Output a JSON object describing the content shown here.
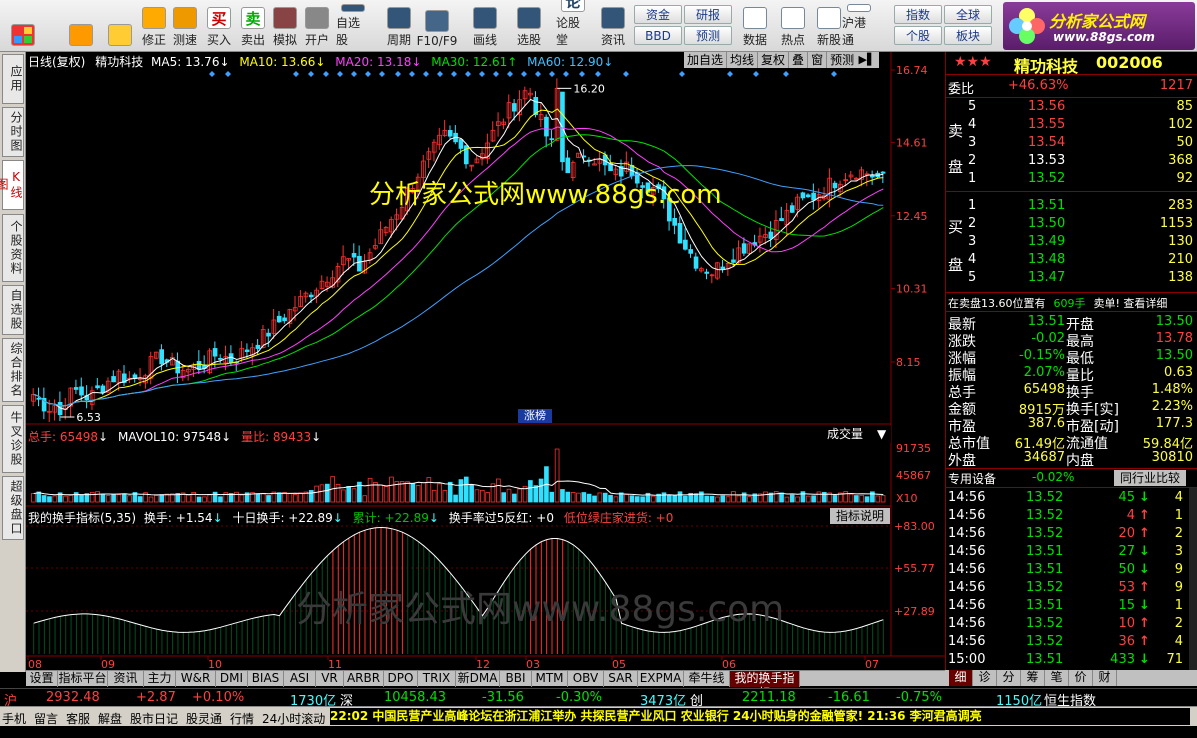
{
  "toolbar": {
    "buttons": [
      {
        "icon": "window-layout-icon",
        "label": ""
      },
      {
        "icon": "back-arrow-icon",
        "label": ""
      },
      {
        "icon": "up-down-arrow-icon",
        "label": ""
      },
      {
        "icon": "edit-icon",
        "label": "修正"
      },
      {
        "icon": "clock-test-icon",
        "label": "测速"
      },
      {
        "icon": "buy-icon",
        "label": "买入",
        "glyph": "买"
      },
      {
        "icon": "sell-icon",
        "label": "卖出",
        "glyph": "卖"
      },
      {
        "icon": "hammer-icon",
        "label": "模拟"
      },
      {
        "icon": "lock-icon",
        "label": "开户"
      },
      {
        "icon": "watchlist-icon",
        "label": "自选股"
      },
      {
        "icon": "period-icon",
        "label": "周期"
      },
      {
        "icon": "f10-icon",
        "label": "F10/F9"
      },
      {
        "icon": "pen-icon",
        "label": "画线"
      },
      {
        "icon": "select-stock-icon",
        "label": "选股"
      },
      {
        "icon": "forum-icon",
        "label": "论股堂",
        "glyph": "论"
      },
      {
        "icon": "news-icon",
        "label": "资讯"
      }
    ],
    "small_buttons": [
      "资金",
      "研报",
      "BBD",
      "预测"
    ],
    "buttons2": [
      {
        "icon": "pe-data-icon",
        "label": "数据"
      },
      {
        "icon": "hot-icon",
        "label": "热点"
      },
      {
        "icon": "new-stock-icon",
        "label": "新股"
      },
      {
        "icon": "sse-hke-icon",
        "label": "沪港通"
      }
    ],
    "small_buttons2": [
      "指数",
      "全球",
      "个股",
      "板块"
    ],
    "logo_text": "分析家公式网",
    "logo_url": "www.88gs.com"
  },
  "leftnav": [
    "应用",
    "分时图",
    "K线图",
    "个股资料",
    "自选股",
    "综合排名",
    "牛叉诊股",
    "超级盘口"
  ],
  "chart": {
    "header": {
      "period": "日线(复权)",
      "name": "精功科技",
      "ma5": "MA5: 13.76",
      "ma10": "MA10: 13.66",
      "ma20": "MA20: 13.18",
      "ma30": "MA30: 12.61",
      "ma60": "MA60: 12.90"
    },
    "top_buttons": [
      "加自选",
      "均线",
      "复权",
      "叠",
      "窗",
      "预测"
    ],
    "price_axis": [
      "16.74",
      "14.61",
      "12.45",
      "10.31",
      "8.15"
    ],
    "high_mark": "16.20",
    "low_mark": "6.53",
    "watermark": "分析家公式网www.88gs.com",
    "watermark2": "分析家公式网www.88gs.com",
    "rank_badge": "涨榜",
    "vol_header": {
      "total": "总手: 65498",
      "mavol": "MAVOL10: 97548",
      "ratio": "量比: 89433"
    },
    "vol_dropdown": "成交量",
    "vol_axis": [
      "91735",
      "45867",
      "X10"
    ],
    "ind_header": {
      "title": "我的换手指标(5,35)",
      "hs": "换手: +1.54",
      "ten": "十日换手: +22.89",
      "sum": "累计: +22.89",
      "over": "换手率过5反红: +0",
      "low": "低位绿庄家进货: +0"
    },
    "ind_button": "指标说明",
    "ind_axis": [
      "+83.00",
      "+55.77",
      "+27.89"
    ],
    "x_labels": [
      "08",
      "09",
      "10",
      "11",
      "12",
      "03",
      "05",
      "06",
      "07"
    ]
  },
  "chart_data": {
    "type": "candlestick",
    "title": "精功科技 日线(复权)",
    "y_axis": [
      6.53,
      16.74
    ],
    "price_path": [
      7.2,
      6.8,
      7.0,
      7.3,
      7.1,
      7.5,
      7.8,
      7.6,
      8.0,
      8.3,
      8.0,
      7.9,
      8.1,
      8.4,
      8.2,
      8.5,
      8.8,
      9.2,
      9.6,
      10.0,
      10.4,
      10.8,
      11.2,
      10.9,
      11.5,
      12.2,
      12.8,
      13.6,
      14.2,
      14.8,
      14.5,
      14.0,
      14.6,
      15.2,
      15.8,
      16.2,
      15.0,
      14.2,
      13.8,
      14.4,
      14.0,
      13.6,
      13.9,
      13.5,
      13.2,
      12.4,
      11.6,
      11.0,
      10.8,
      11.2,
      11.5,
      11.8,
      12.0,
      12.4,
      12.8,
      13.0,
      13.3,
      13.6,
      13.8,
      13.7,
      13.5
    ],
    "ma_lines": [
      "MA5",
      "MA10",
      "MA20",
      "MA30",
      "MA60"
    ]
  },
  "quote": {
    "stars": "★★★",
    "name": "精功科技",
    "code": "002006",
    "wb_label": "委比",
    "wb_val": "+46.63%",
    "wb_num": "1217",
    "sell_label": [
      "卖",
      "盘"
    ],
    "buy_label": [
      "买",
      "盘"
    ],
    "asks": [
      {
        "i": "5",
        "p": "13.56",
        "v": "85"
      },
      {
        "i": "4",
        "p": "13.55",
        "v": "102"
      },
      {
        "i": "3",
        "p": "13.54",
        "v": "50"
      },
      {
        "i": "2",
        "p": "13.53",
        "v": "368"
      },
      {
        "i": "1",
        "p": "13.52",
        "v": "92"
      }
    ],
    "bids": [
      {
        "i": "1",
        "p": "13.51",
        "v": "283"
      },
      {
        "i": "2",
        "p": "13.50",
        "v": "1153"
      },
      {
        "i": "3",
        "p": "13.49",
        "v": "130"
      },
      {
        "i": "4",
        "p": "13.48",
        "v": "210"
      },
      {
        "i": "5",
        "p": "13.47",
        "v": "138"
      }
    ],
    "note": "在卖盘13.60位置有",
    "note_vol": "609手",
    "note_link": "卖单! 查看详细",
    "stats": [
      {
        "k1": "最新",
        "v1": "13.51",
        "k2": "开盘",
        "v2": "13.50"
      },
      {
        "k1": "涨跌",
        "v1": "-0.02",
        "k2": "最高",
        "v2": "13.78"
      },
      {
        "k1": "涨幅",
        "v1": "-0.15%",
        "k2": "最低",
        "v2": "13.50"
      },
      {
        "k1": "振幅",
        "v1": "2.07%",
        "k2": "量比",
        "v2": "0.63"
      },
      {
        "k1": "总手",
        "v1": "65498",
        "k2": "换手",
        "v2": "1.48%"
      },
      {
        "k1": "金额",
        "v1": "8915万",
        "k2": "换手[实]",
        "v2": "2.23%"
      },
      {
        "k1": "市盈",
        "v1": "387.6",
        "k2": "市盈[动]",
        "v2": "177.3"
      },
      {
        "k1": "总市值",
        "v1": "61.49亿",
        "k2": "流通值",
        "v2": "59.84亿"
      },
      {
        "k1": "外盘",
        "v1": "34687",
        "k2": "内盘",
        "v2": "30810"
      }
    ],
    "sector": "专用设备",
    "sector_chg": "-0.02%",
    "peer": "同行业比较",
    "ticks": [
      {
        "t": "14:56",
        "p": "13.52",
        "v": "45",
        "d": "down",
        "n": "4"
      },
      {
        "t": "14:56",
        "p": "13.52",
        "v": "4",
        "d": "up",
        "n": "1"
      },
      {
        "t": "14:56",
        "p": "13.52",
        "v": "20",
        "d": "up",
        "n": "2"
      },
      {
        "t": "14:56",
        "p": "13.51",
        "v": "27",
        "d": "down",
        "n": "3"
      },
      {
        "t": "14:56",
        "p": "13.51",
        "v": "50",
        "d": "down",
        "n": "9"
      },
      {
        "t": "14:56",
        "p": "13.52",
        "v": "53",
        "d": "up",
        "n": "9"
      },
      {
        "t": "14:56",
        "p": "13.51",
        "v": "15",
        "d": "down",
        "n": "1"
      },
      {
        "t": "14:56",
        "p": "13.52",
        "v": "10",
        "d": "up",
        "n": "2"
      },
      {
        "t": "14:56",
        "p": "13.52",
        "v": "36",
        "d": "up",
        "n": "4"
      },
      {
        "t": "15:00",
        "p": "13.51",
        "v": "433",
        "d": "down",
        "n": "71"
      }
    ]
  },
  "bottom_tabs": [
    "设置",
    "指标平台",
    "资讯",
    "主力",
    "W&R",
    "DMI",
    "BIAS",
    "ASI",
    "VR",
    "ARBR",
    "DPO",
    "TRIX",
    "新DMA",
    "BBI",
    "MTM",
    "OBV",
    "SAR",
    "EXPMA",
    "牵牛线",
    "我的换手指标"
  ],
  "right_tabs": [
    "细",
    "诊",
    "分",
    "筹",
    "笔",
    "价",
    "财"
  ],
  "status": {
    "sh_label": "沪",
    "sh_val": "2932.48",
    "sh_chg": "+2.87",
    "sh_pct": "+0.10%",
    "sh_amt": "1730亿",
    "sz_label": "深",
    "sz_val": "10458.43",
    "sz_chg": "-31.56",
    "sz_pct": "-0.30%",
    "sz_amt": "3473亿",
    "cy_label": "创",
    "cy_val": "2211.18",
    "cy_chg": "-16.61",
    "cy_pct": "-0.75%",
    "cy_amt": "1150亿",
    "hs_label": "恒生指数"
  },
  "ticker": {
    "items": [
      "手机",
      "留言",
      "客服",
      "解盘",
      "股市日记",
      "股灵通",
      "行情",
      "24小时滚动"
    ],
    "news": "22:02 中国民营产业高峰论坛在浙江浦江举办 共探民营产业风口   农业银行 24小时贴身的金融管家!   21:36 李河君高调亮"
  }
}
